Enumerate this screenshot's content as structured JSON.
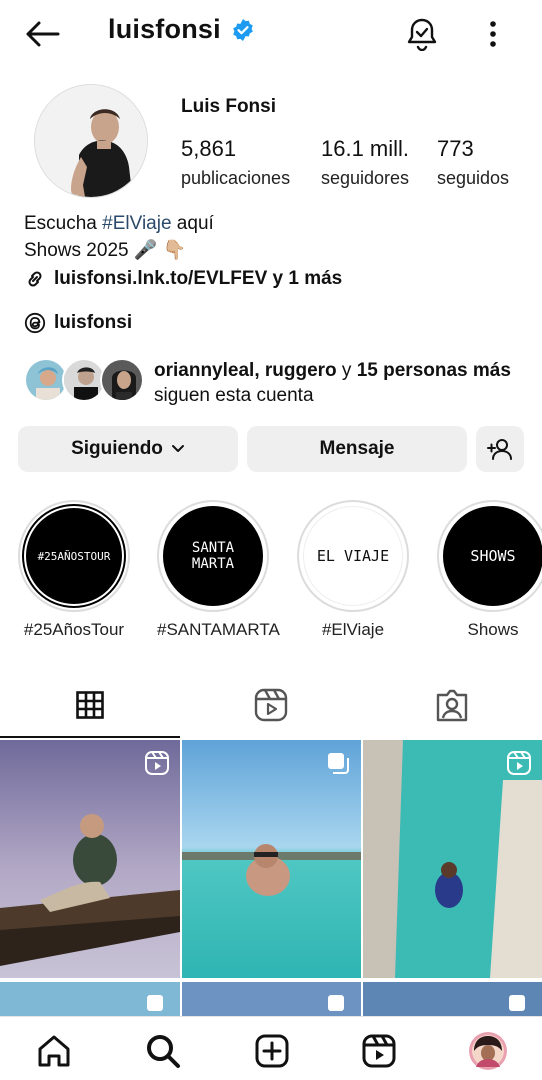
{
  "header": {
    "username": "luisfonsi"
  },
  "profile": {
    "full_name": "Luis Fonsi",
    "stats": [
      {
        "value": "5,861",
        "label": "publicaciones"
      },
      {
        "value": "16.1 mill.",
        "label": "seguidores"
      },
      {
        "value": "773",
        "label": "seguidos"
      }
    ],
    "bio": {
      "line1_prefix": "Escucha ",
      "line1_tag": "#ElViaje",
      "line1_suffix": " aquí",
      "line2": "Shows 2025 🎤 👇🏼"
    },
    "link": "luisfonsi.lnk.to/EVLFEV y 1 más",
    "threads_handle": "luisfonsi",
    "followed_by": {
      "names": "oriannyleal, ruggero",
      "connector": " y ",
      "count_text": "15 personas más",
      "suffix": " siguen esta cuenta"
    }
  },
  "actions": {
    "following_label": "Siguiendo",
    "message_label": "Mensaje"
  },
  "highlights": [
    {
      "label": "#25AñosTour",
      "cover_text": "#25AÑOSTOUR"
    },
    {
      "label": "#SANTAMARTA",
      "cover_text_1": "SANTA",
      "cover_text_2": "MARTA"
    },
    {
      "label": "#ElViaje",
      "cover_text": "EL VIAJE"
    },
    {
      "label": "Shows",
      "cover_text": "SHOWS"
    }
  ],
  "colors": {
    "verified": "#1d9bf0",
    "hashtag": "#2b4a6b",
    "button_bg": "#efefef"
  },
  "icons": {
    "back": "arrow-left-icon",
    "bell": "bell-check-icon",
    "more": "more-vertical-icon",
    "link": "link-icon",
    "threads": "threads-icon",
    "add_person": "add-person-icon",
    "grid": "grid-icon",
    "reels": "reels-icon",
    "tagged": "tagged-icon"
  }
}
